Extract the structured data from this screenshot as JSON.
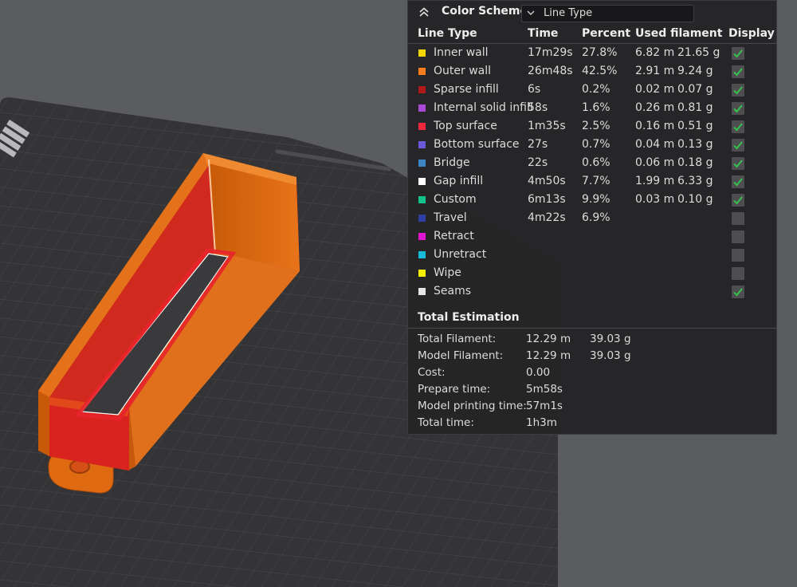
{
  "colors": {
    "background": "#5b5c60",
    "plate": "#333335",
    "model_orange": "#e36d12",
    "model_red": "#d4232a",
    "panel_bg": "#242425",
    "check_green": "#35c24f"
  },
  "icons": {
    "collapse": "double-chevron-up-icon",
    "dropdown": "chevron-down-icon",
    "check": "checkmark-icon"
  },
  "plate_logo": "Bambu",
  "panel": {
    "title": "Color Scheme",
    "scheme_select": "Line Type",
    "columns": [
      "Line Type",
      "Time",
      "Percent",
      "Used filament",
      "Display"
    ],
    "rows": [
      {
        "name": "Inner wall",
        "color": "#f2d600",
        "time": "17m29s",
        "percent": "27.8%",
        "length": "6.82 m",
        "weight": "21.65 g",
        "display": true
      },
      {
        "name": "Outer wall",
        "color": "#ff7d1c",
        "time": "26m48s",
        "percent": "42.5%",
        "length": "2.91 m",
        "weight": "9.24 g",
        "display": true
      },
      {
        "name": "Sparse infill",
        "color": "#b01919",
        "time": "6s",
        "percent": "0.2%",
        "length": "0.02 m",
        "weight": "0.07 g",
        "display": true
      },
      {
        "name": "Internal solid infill",
        "color": "#a94ad6",
        "time": "58s",
        "percent": "1.6%",
        "length": "0.26 m",
        "weight": "0.81 g",
        "display": true
      },
      {
        "name": "Top surface",
        "color": "#f0283c",
        "time": "1m35s",
        "percent": "2.5%",
        "length": "0.16 m",
        "weight": "0.51 g",
        "display": true
      },
      {
        "name": "Bottom surface",
        "color": "#6a5ad9",
        "time": "27s",
        "percent": "0.7%",
        "length": "0.04 m",
        "weight": "0.13 g",
        "display": true
      },
      {
        "name": "Bridge",
        "color": "#3d86c4",
        "time": "22s",
        "percent": "0.6%",
        "length": "0.06 m",
        "weight": "0.18 g",
        "display": true
      },
      {
        "name": "Gap infill",
        "color": "#ffffff",
        "time": "4m50s",
        "percent": "7.7%",
        "length": "1.99 m",
        "weight": "6.33 g",
        "display": true
      },
      {
        "name": "Custom",
        "color": "#12c28a",
        "time": "6m13s",
        "percent": "9.9%",
        "length": "0.03 m",
        "weight": "0.10 g",
        "display": true
      },
      {
        "name": "Travel",
        "color": "#2e3fa3",
        "time": "4m22s",
        "percent": "6.9%",
        "length": "",
        "weight": "",
        "display": false
      },
      {
        "name": "Retract",
        "color": "#e015d1",
        "time": "",
        "percent": "",
        "length": "",
        "weight": "",
        "display": false
      },
      {
        "name": "Unretract",
        "color": "#17bcd9",
        "time": "",
        "percent": "",
        "length": "",
        "weight": "",
        "display": false
      },
      {
        "name": "Wipe",
        "color": "#f5f000",
        "time": "",
        "percent": "",
        "length": "",
        "weight": "",
        "display": false
      },
      {
        "name": "Seams",
        "color": "#e6e6e6",
        "time": "",
        "percent": "",
        "length": "",
        "weight": "",
        "display": true
      }
    ],
    "estimation": {
      "title": "Total Estimation",
      "rows": [
        {
          "label": "Total Filament:",
          "v1": "12.29 m",
          "v2": "39.03 g"
        },
        {
          "label": "Model Filament:",
          "v1": "12.29 m",
          "v2": "39.03 g"
        },
        {
          "label": "Cost:",
          "v1": "0.00",
          "v2": ""
        },
        {
          "label": "Prepare time:",
          "v1": "5m58s",
          "v2": ""
        },
        {
          "label": "Model printing time:",
          "v1": "57m1s",
          "v2": ""
        },
        {
          "label": "Total time:",
          "v1": "1h3m",
          "v2": ""
        }
      ]
    }
  }
}
